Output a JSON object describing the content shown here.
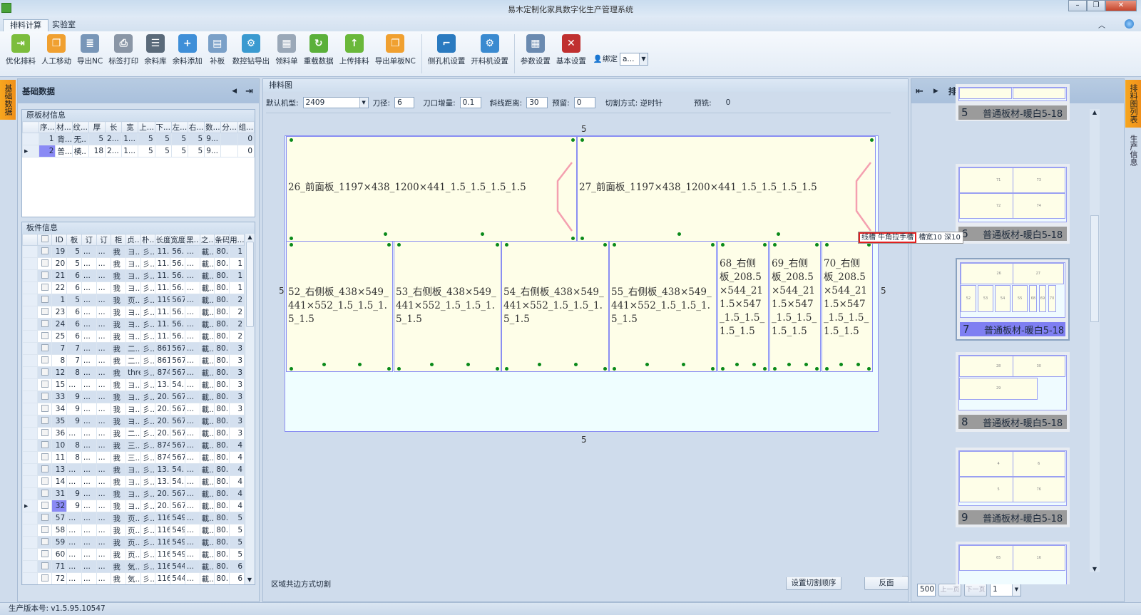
{
  "window": {
    "title": "易木定制化家具数字化生产管理系统",
    "min": "–",
    "max": "❐",
    "close": "✕"
  },
  "tabs": [
    {
      "label": "排料计算"
    },
    {
      "label": "实验室"
    }
  ],
  "ribbon": {
    "groups": [
      [
        {
          "label": "优化排料",
          "icon": "optimize-icon",
          "color": "#7cbd3c",
          "glyph": "⇥"
        },
        {
          "label": "人工移动",
          "icon": "manual-move-icon",
          "color": "#f0a030",
          "glyph": "❐"
        },
        {
          "label": "导出NC",
          "icon": "export-nc-icon",
          "color": "#7896b8",
          "glyph": "≣"
        },
        {
          "label": "标签打印",
          "icon": "printer-icon",
          "color": "#8a96a6",
          "glyph": "⎙"
        },
        {
          "label": "余料库",
          "icon": "remnant-library-icon",
          "color": "#5a6a7a",
          "glyph": "☰"
        },
        {
          "label": "余料添加",
          "icon": "add-remnant-icon",
          "color": "#3f8fd8",
          "glyph": "+"
        },
        {
          "label": "补板",
          "icon": "patch-board-icon",
          "color": "#7aa0c8",
          "glyph": "▤"
        },
        {
          "label": "数控钻导出",
          "icon": "cnc-drill-export-icon",
          "color": "#3a9ad0",
          "glyph": "⚙"
        },
        {
          "label": "领料单",
          "icon": "material-list-icon",
          "color": "#9aa8b8",
          "glyph": "▦"
        },
        {
          "label": "重载数据",
          "icon": "reload-icon",
          "color": "#5bb03a",
          "glyph": "↻"
        },
        {
          "label": "上传排料",
          "icon": "upload-icon",
          "color": "#6ab83a",
          "glyph": "↑"
        },
        {
          "label": "导出单板NC",
          "icon": "export-single-nc-icon",
          "color": "#f0a030",
          "glyph": "❐"
        }
      ],
      [
        {
          "label": "侧孔机设置",
          "icon": "side-drill-settings-icon",
          "color": "#2a7ac0",
          "glyph": "⌐"
        },
        {
          "label": "开料机设置",
          "icon": "cutter-settings-icon",
          "color": "#3a8ad0",
          "glyph": "⚙"
        }
      ],
      [
        {
          "label": "参数设置",
          "icon": "parameter-settings-icon",
          "color": "#6a8ab0",
          "glyph": "▦"
        },
        {
          "label": "基本设置",
          "icon": "basic-settings-icon",
          "color": "#c03030",
          "glyph": "✕"
        }
      ]
    ],
    "bind_label": "绑定",
    "bind_value": "a..."
  },
  "left": {
    "vtab": "基础数据",
    "title": "基础数据",
    "raw": {
      "title": "原板材信息",
      "headers": [
        "序...",
        "材...",
        "纹...",
        "厚",
        "长",
        "宽",
        "上...",
        "下...",
        "左...",
        "右...",
        "数...",
        "分...",
        "组..."
      ],
      "rows": [
        [
          "1",
          "背...",
          "无..",
          "5",
          "2...",
          "1...",
          "5",
          "5",
          "5",
          "5",
          "9...",
          "",
          "0"
        ],
        [
          "2",
          "普...",
          "横..",
          "18",
          "2...",
          "1...",
          "5",
          "5",
          "5",
          "5",
          "9...",
          "",
          "0"
        ]
      ]
    },
    "parts": {
      "title": "板件信息",
      "headers": [
        "ID",
        "板",
        "订",
        "订",
        "柜",
        "贞..",
        "朴..",
        "长度",
        "宽度",
        "黑..",
        "之..",
        "条码",
        "用..."
      ],
      "rows": [
        [
          "19",
          "5",
          "...",
          "...",
          "我",
          "ヨ..",
          "彡..",
          "11...",
          "56...",
          "...",
          "載..",
          "80...",
          "1"
        ],
        [
          "20",
          "5",
          "...",
          "...",
          "我",
          "ヨ..",
          "彡..",
          "11...",
          "56...",
          "...",
          "載..",
          "80...",
          "1"
        ],
        [
          "21",
          "6",
          "...",
          "...",
          "我",
          "ヨ..",
          "彡..",
          "11...",
          "56...",
          "...",
          "載..",
          "80...",
          "1"
        ],
        [
          "22",
          "6",
          "...",
          "...",
          "我",
          "ヨ..",
          "彡..",
          "11...",
          "56...",
          "...",
          "載..",
          "80...",
          "1"
        ],
        [
          "1",
          "5",
          "...",
          "...",
          "我",
          "页..",
          "彡..",
          "1192",
          "567",
          "...",
          "載..",
          "80...",
          "2"
        ],
        [
          "23",
          "6",
          "...",
          "...",
          "我",
          "ヨ..",
          "彡..",
          "11...",
          "56...",
          "...",
          "載..",
          "80...",
          "2"
        ],
        [
          "24",
          "6",
          "...",
          "...",
          "我",
          "ヨ..",
          "彡..",
          "11...",
          "56...",
          "...",
          "載..",
          "80...",
          "2"
        ],
        [
          "25",
          "6",
          "...",
          "...",
          "我",
          "ヨ..",
          "彡..",
          "11...",
          "56...",
          "...",
          "載..",
          "80...",
          "2"
        ],
        [
          "7",
          "7",
          "...",
          "...",
          "我",
          "二..",
          "彡..",
          "861",
          "567",
          "...",
          "載..",
          "80...",
          "3"
        ],
        [
          "8",
          "7",
          "...",
          "...",
          "我",
          "二..",
          "彡..",
          "861",
          "567",
          "...",
          "載..",
          "80...",
          "3"
        ],
        [
          "12",
          "8",
          "...",
          "...",
          "我",
          "three..",
          "彡..",
          "874",
          "567",
          "...",
          "載..",
          "80...",
          "3"
        ],
        [
          "15",
          "...",
          "...",
          "...",
          "我",
          "ヨ..",
          "彡..",
          "13...",
          "54...",
          "...",
          "載..",
          "80...",
          "3"
        ],
        [
          "33",
          "9",
          "...",
          "...",
          "我",
          "ヨ..",
          "彡..",
          "20...",
          "567",
          "...",
          "載..",
          "80...",
          "3"
        ],
        [
          "34",
          "9",
          "...",
          "...",
          "我",
          "ヨ..",
          "彡..",
          "20...",
          "567",
          "...",
          "載..",
          "80...",
          "3"
        ],
        [
          "35",
          "9",
          "...",
          "...",
          "我",
          "ヨ..",
          "彡..",
          "20...",
          "567",
          "...",
          "載..",
          "80...",
          "3"
        ],
        [
          "36",
          "...",
          "...",
          "...",
          "我",
          "二..",
          "彡..",
          "20...",
          "567",
          "...",
          "載..",
          "80...",
          "3"
        ],
        [
          "10",
          "8",
          "...",
          "...",
          "我",
          "三..",
          "彡..",
          "874",
          "567",
          "...",
          "載..",
          "80...",
          "4"
        ],
        [
          "11",
          "8",
          "...",
          "...",
          "我",
          "三..",
          "彡..",
          "874",
          "567",
          "...",
          "載..",
          "80...",
          "4"
        ],
        [
          "13",
          "...",
          "...",
          "...",
          "我",
          "ヨ..",
          "彡..",
          "13...",
          "54...",
          "...",
          "載..",
          "80...",
          "4"
        ],
        [
          "14",
          "...",
          "...",
          "...",
          "我",
          "ヨ..",
          "彡..",
          "13...",
          "54...",
          "...",
          "載..",
          "80...",
          "4"
        ],
        [
          "31",
          "9",
          "...",
          "...",
          "我",
          "ヨ..",
          "彡..",
          "20...",
          "567",
          "...",
          "載..",
          "80...",
          "4"
        ],
        [
          "32",
          "9",
          "...",
          "...",
          "我",
          "ヨ..",
          "彡..",
          "20...",
          "567",
          "...",
          "載..",
          "80...",
          "4"
        ],
        [
          "57",
          "...",
          "...",
          "...",
          "我",
          "页..",
          "彡..",
          "1161",
          "549",
          "...",
          "載..",
          "80...",
          "5"
        ],
        [
          "58",
          "...",
          "...",
          "...",
          "我",
          "页..",
          "彡..",
          "1161",
          "549",
          "...",
          "載..",
          "80...",
          "5"
        ],
        [
          "59",
          "...",
          "...",
          "...",
          "我",
          "页..",
          "彡..",
          "1161",
          "549",
          "...",
          "載..",
          "80...",
          "5"
        ],
        [
          "60",
          "...",
          "...",
          "...",
          "我",
          "页..",
          "彡..",
          "1161",
          "549",
          "...",
          "載..",
          "80...",
          "5"
        ],
        [
          "71",
          "...",
          "...",
          "...",
          "我",
          "気..",
          "彡..",
          "1161",
          "544",
          "...",
          "載..",
          "80...",
          "6"
        ],
        [
          "72",
          "...",
          "...",
          "...",
          "我",
          "気..",
          "彡..",
          "1161",
          "544",
          "...",
          "載..",
          "80...",
          "6"
        ]
      ],
      "selected_id": "32"
    }
  },
  "center": {
    "title": "排料图",
    "params": {
      "machine_label": "默认机型:",
      "machine": "2409",
      "tool_label": "刀径:",
      "tool": "6",
      "kerf_label": "刀口增量:",
      "kerf": "0.1",
      "slant_label": "斜线距离:",
      "slant": "30",
      "reserve_label": "预留:",
      "reserve": "0",
      "cut_label": "切割方式: 逆时针",
      "mill_label": "预铣:",
      "mill": "0"
    },
    "margins": {
      "top": "5",
      "bottom": "5",
      "left": "5",
      "right": "5"
    },
    "pieces": [
      "26_前面板_1197×438_1200×441_1.5_1.5_1.5_1.5",
      "27_前面板_1197×438_1200×441_1.5_1.5_1.5_1.5",
      "52_右侧板_438×549_441×552_1.5_1.5_1.5_1.5",
      "53_右侧板_438×549_441×552_1.5_1.5_1.5_1.5",
      "54_右侧板_438×549_441×552_1.5_1.5_1.5_1.5",
      "55_右侧板_438×549_441×552_1.5_1.5_1.5_1.5",
      "68_右侧板_208.5×544_211.5×547_1.5_1.5_1.5_1.5",
      "69_右侧板_208.5×544_211.5×547_1.5_1.5_1.5_1.5",
      "70_右侧板_208.5×544_211.5×547_1.5_1.5_1.5_1.5"
    ],
    "tooltip_highlight": "线槽 牛角拉手槽",
    "tooltip_rest": "槽宽10 深10",
    "footer_text": "区域共边方式切割",
    "cut_order_btn": "设置切割顺序",
    "reverse_btn": "反面"
  },
  "right": {
    "title": "排料图列表",
    "vtabs": [
      "排料图列表",
      "生产信息"
    ],
    "sheets": [
      {
        "no": "5",
        "name": "普通板材-暖白5-18",
        "parts": []
      },
      {
        "no": "6",
        "name": "普通板材-暖白5-18",
        "parts": [
          "71",
          "73",
          "72",
          "74"
        ]
      },
      {
        "no": "7",
        "name": "普通板材-暖白5-18",
        "parts": [
          "26",
          "27",
          "52",
          "53",
          "54",
          "55",
          "68",
          "69",
          "70"
        ]
      },
      {
        "no": "8",
        "name": "普通板材-暖白5-18",
        "parts": [
          "28",
          "30",
          "29"
        ]
      },
      {
        "no": "9",
        "name": "普通板材-暖白5-18",
        "parts": [
          "4",
          "6",
          "5",
          "76"
        ]
      },
      {
        "no": "",
        "name": "",
        "parts": [
          "65",
          "16"
        ]
      }
    ],
    "selected_sheet": "7",
    "page_size": "500",
    "prev": "上一页",
    "next": "下一页",
    "page": "1"
  },
  "status": {
    "version": "生产版本号:  v1.5.95.10547"
  }
}
